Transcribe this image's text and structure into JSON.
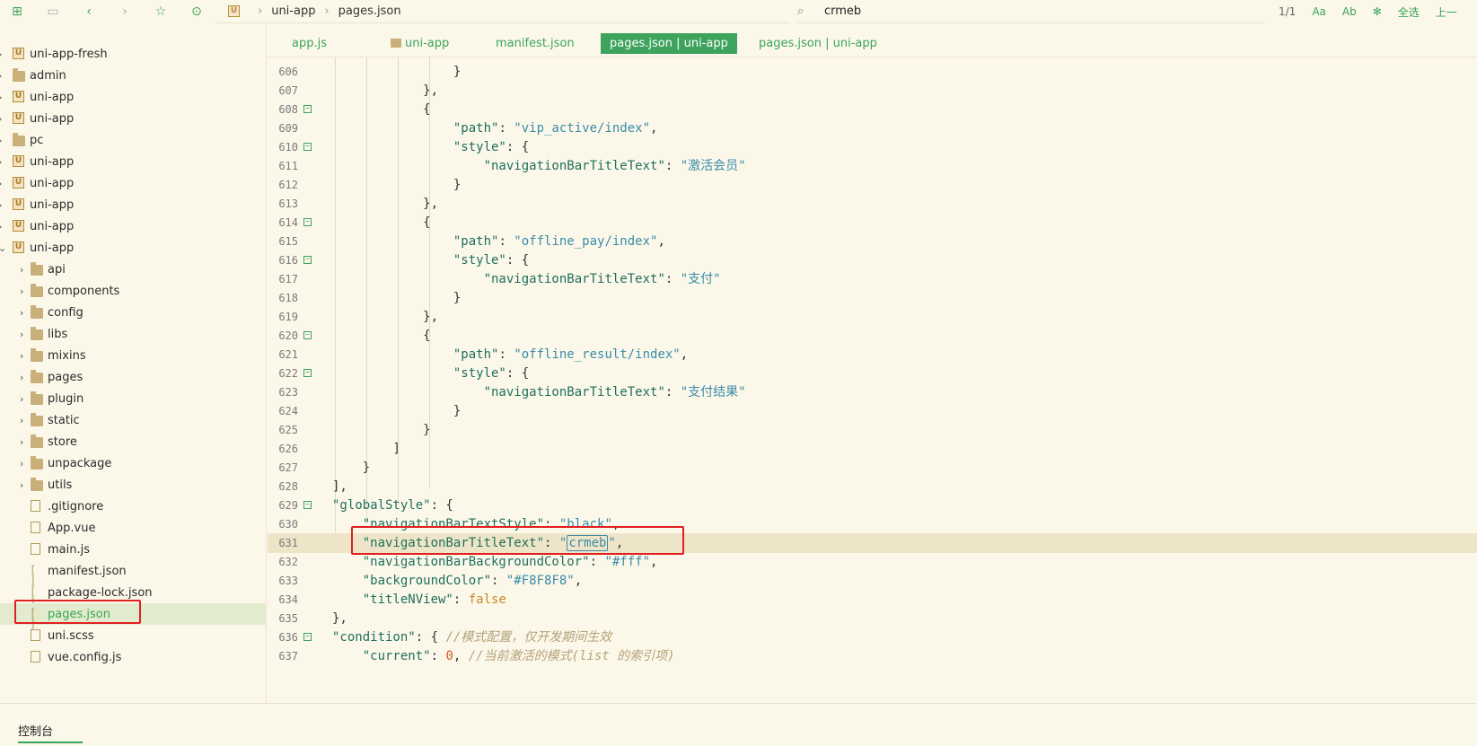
{
  "toolbar": {
    "icons": [
      "new-file-icon",
      "save-icon",
      "back-icon",
      "forward-icon",
      "star-icon",
      "run-icon"
    ],
    "breadcrumb": [
      "uni-app",
      "pages.json"
    ],
    "search_text": "crmeb",
    "match_count": "1/1",
    "right_labels": [
      "Aa",
      "Ab",
      "全选",
      "上一"
    ]
  },
  "sidebar": {
    "items": [
      {
        "label": "uni-app-fresh",
        "icon": "project-u-icon",
        "level": 0,
        "arrow": "›"
      },
      {
        "label": "admin",
        "icon": "folder-icon",
        "level": 0,
        "arrow": "›"
      },
      {
        "label": "uni-app",
        "icon": "project-u-icon",
        "level": 0,
        "arrow": "›"
      },
      {
        "label": "uni-app",
        "icon": "project-u-icon",
        "level": 0,
        "arrow": "›"
      },
      {
        "label": "pc",
        "icon": "folder-icon",
        "level": 0,
        "arrow": "›"
      },
      {
        "label": "uni-app",
        "icon": "project-u-icon",
        "level": 0,
        "arrow": "›"
      },
      {
        "label": "uni-app",
        "icon": "project-u-icon",
        "level": 0,
        "arrow": "›"
      },
      {
        "label": "uni-app",
        "icon": "project-u-icon",
        "level": 0,
        "arrow": "›"
      },
      {
        "label": "uni-app",
        "icon": "project-u-icon",
        "level": 0,
        "arrow": "›"
      },
      {
        "label": "uni-app",
        "icon": "project-u-icon",
        "level": 0,
        "arrow": "⌄"
      },
      {
        "label": "api",
        "icon": "folder-icon",
        "level": 1,
        "arrow": "›"
      },
      {
        "label": "components",
        "icon": "folder-icon",
        "level": 1,
        "arrow": "›"
      },
      {
        "label": "config",
        "icon": "folder-icon",
        "level": 1,
        "arrow": "›"
      },
      {
        "label": "libs",
        "icon": "folder-icon",
        "level": 1,
        "arrow": "›"
      },
      {
        "label": "mixins",
        "icon": "folder-icon",
        "level": 1,
        "arrow": "›"
      },
      {
        "label": "pages",
        "icon": "folder-icon",
        "level": 1,
        "arrow": "›"
      },
      {
        "label": "plugin",
        "icon": "folder-icon",
        "level": 1,
        "arrow": "›"
      },
      {
        "label": "static",
        "icon": "folder-icon",
        "level": 1,
        "arrow": "›"
      },
      {
        "label": "store",
        "icon": "folder-icon",
        "level": 1,
        "arrow": "›"
      },
      {
        "label": "unpackage",
        "icon": "folder-icon",
        "level": 1,
        "arrow": "›"
      },
      {
        "label": "utils",
        "icon": "folder-icon",
        "level": 1,
        "arrow": "›"
      },
      {
        "label": ".gitignore",
        "icon": "file-icon",
        "level": 1,
        "arrow": ""
      },
      {
        "label": "App.vue",
        "icon": "file-icon",
        "level": 1,
        "arrow": ""
      },
      {
        "label": "main.js",
        "icon": "file-icon",
        "level": 1,
        "arrow": ""
      },
      {
        "label": "manifest.json",
        "icon": "json-icon",
        "level": 1,
        "arrow": ""
      },
      {
        "label": "package-lock.json",
        "icon": "json-icon",
        "level": 1,
        "arrow": ""
      },
      {
        "label": "pages.json",
        "icon": "json-icon",
        "level": 1,
        "arrow": "",
        "selected": true
      },
      {
        "label": "uni.scss",
        "icon": "file-icon",
        "level": 1,
        "arrow": ""
      },
      {
        "label": "vue.config.js",
        "icon": "file-icon",
        "level": 1,
        "arrow": ""
      }
    ]
  },
  "tabs": [
    {
      "label": "app.js",
      "active": false
    },
    {
      "label": "uni-app",
      "active": false,
      "folder": true
    },
    {
      "label": "manifest.json",
      "active": false
    },
    {
      "label": "pages.json | uni-app",
      "active": true
    },
    {
      "label": "pages.json | uni-app",
      "active": false
    }
  ],
  "editor": {
    "lines": [
      {
        "num": "606",
        "fold": false,
        "html": "                <span class=\"p\">}</span>"
      },
      {
        "num": "607",
        "fold": false,
        "html": "            <span class=\"p\">},</span>"
      },
      {
        "num": "608",
        "fold": true,
        "html": "            <span class=\"p\">{</span>"
      },
      {
        "num": "609",
        "fold": false,
        "html": "                <span class=\"k\">\"path\"</span><span class=\"p\">: </span><span class=\"s\">\"vip_active/index\"</span><span class=\"p\">,</span>"
      },
      {
        "num": "610",
        "fold": true,
        "html": "                <span class=\"k\">\"style\"</span><span class=\"p\">: {</span>"
      },
      {
        "num": "611",
        "fold": false,
        "html": "                    <span class=\"k\">\"navigationBarTitleText\"</span><span class=\"p\">: </span><span class=\"s\">\"激活会员\"</span>"
      },
      {
        "num": "612",
        "fold": false,
        "html": "                <span class=\"p\">}</span>"
      },
      {
        "num": "613",
        "fold": false,
        "html": "            <span class=\"p\">},</span>"
      },
      {
        "num": "614",
        "fold": true,
        "html": "            <span class=\"p\">{</span>"
      },
      {
        "num": "615",
        "fold": false,
        "html": "                <span class=\"k\">\"path\"</span><span class=\"p\">: </span><span class=\"s\">\"offline_pay/index\"</span><span class=\"p\">,</span>"
      },
      {
        "num": "616",
        "fold": true,
        "html": "                <span class=\"k\">\"style\"</span><span class=\"p\">: {</span>"
      },
      {
        "num": "617",
        "fold": false,
        "html": "                    <span class=\"k\">\"navigationBarTitleText\"</span><span class=\"p\">: </span><span class=\"s\">\"支付\"</span>"
      },
      {
        "num": "618",
        "fold": false,
        "html": "                <span class=\"p\">}</span>"
      },
      {
        "num": "619",
        "fold": false,
        "html": "            <span class=\"p\">},</span>"
      },
      {
        "num": "620",
        "fold": true,
        "html": "            <span class=\"p\">{</span>"
      },
      {
        "num": "621",
        "fold": false,
        "html": "                <span class=\"k\">\"path\"</span><span class=\"p\">: </span><span class=\"s\">\"offline_result/index\"</span><span class=\"p\">,</span>"
      },
      {
        "num": "622",
        "fold": true,
        "html": "                <span class=\"k\">\"style\"</span><span class=\"p\">: {</span>"
      },
      {
        "num": "623",
        "fold": false,
        "html": "                    <span class=\"k\">\"navigationBarTitleText\"</span><span class=\"p\">: </span><span class=\"s\">\"支付结果\"</span>"
      },
      {
        "num": "624",
        "fold": false,
        "html": "                <span class=\"p\">}</span>"
      },
      {
        "num": "625",
        "fold": false,
        "html": "            <span class=\"p\">}</span>"
      },
      {
        "num": "626",
        "fold": false,
        "html": "        <span class=\"p\">]</span>"
      },
      {
        "num": "627",
        "fold": false,
        "html": "    <span class=\"p\">}</span>"
      },
      {
        "num": "628",
        "fold": false,
        "html": "<span class=\"p\">],</span>"
      },
      {
        "num": "629",
        "fold": true,
        "html": "<span class=\"k\">\"globalStyle\"</span><span class=\"p\">: {</span>"
      },
      {
        "num": "630",
        "fold": false,
        "html": "    <span class=\"k\">\"navigationBarTextStyle\"</span><span class=\"p\">: </span><span class=\"s\">\"black\"</span><span class=\"p\">,</span>"
      },
      {
        "num": "631",
        "fold": false,
        "hl": true,
        "html": "    <span class=\"k\">\"navigationBarTitleText\"</span><span class=\"p\">: </span><span class=\"s\">\"<span class=\"match\">crmeb</span>\"</span><span class=\"p\">,</span>"
      },
      {
        "num": "632",
        "fold": false,
        "html": "    <span class=\"k\">\"navigationBarBackgroundColor\"</span><span class=\"p\">: </span><span class=\"s\">\"#fff\"</span><span class=\"p\">,</span>"
      },
      {
        "num": "633",
        "fold": false,
        "html": "    <span class=\"k\">\"backgroundColor\"</span><span class=\"p\">: </span><span class=\"s\">\"#F8F8F8\"</span><span class=\"p\">,</span>"
      },
      {
        "num": "634",
        "fold": false,
        "html": "    <span class=\"k\">\"titleNView\"</span><span class=\"p\">: </span><span class=\"b\">false</span>"
      },
      {
        "num": "635",
        "fold": false,
        "html": "<span class=\"p\">},</span>"
      },
      {
        "num": "636",
        "fold": true,
        "html": "<span class=\"k\">\"condition\"</span><span class=\"p\">: { </span><span class=\"c\">//模式配置，仅开发期间生效</span>"
      },
      {
        "num": "637",
        "fold": false,
        "html": "    <span class=\"k\">\"current\"</span><span class=\"p\">: </span><span class=\"n\">0</span><span class=\"p\">, </span><span class=\"c\">//当前激活的模式(list 的索引项)</span>"
      }
    ]
  },
  "bottom": {
    "console_label": "控制台"
  },
  "colors": {
    "accent": "#3aa35a",
    "highlight_box": "#e02020",
    "background": "#fbf8ea"
  }
}
